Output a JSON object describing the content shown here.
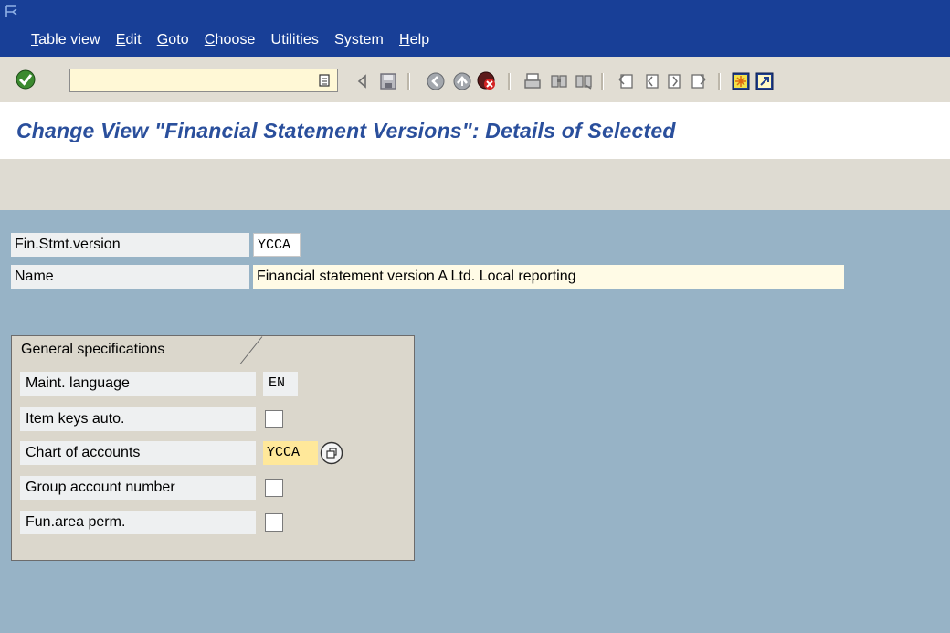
{
  "menu": {
    "items": [
      {
        "mnemonic": "T",
        "rest": "able view"
      },
      {
        "mnemonic": "E",
        "rest": "dit"
      },
      {
        "mnemonic": "G",
        "rest": "oto"
      },
      {
        "mnemonic": "C",
        "rest": "hoose"
      },
      {
        "mnemonic": "",
        "rest": "Utilities"
      },
      {
        "mnemonic": "",
        "rest": "System"
      },
      {
        "mnemonic": "H",
        "rest": "elp"
      }
    ]
  },
  "toolbar": {
    "command_field_value": "",
    "icons": [
      "enter-icon",
      "back-arrow-icon",
      "save-icon",
      "back-icon",
      "exit-icon",
      "cancel-icon",
      "print-icon",
      "find-icon",
      "find-next-icon",
      "first-page-icon",
      "previous-page-icon",
      "next-page-icon",
      "last-page-icon",
      "create-session-icon",
      "shortcut-icon"
    ]
  },
  "page": {
    "title": "Change View \"Financial Statement Versions\": Details of Selected"
  },
  "fields": {
    "fin_stmt_version": {
      "label": "Fin.Stmt.version",
      "value": "YCCA"
    },
    "name": {
      "label": "Name",
      "value": "Financial statement version A Ltd. Local reporting"
    }
  },
  "general_specifications": {
    "title": "General specifications",
    "maint_language": {
      "label": "Maint. language",
      "value": "EN"
    },
    "item_keys_auto": {
      "label": "Item keys auto.",
      "checked": false
    },
    "chart_of_accounts": {
      "label": "Chart of accounts",
      "value": "YCCA"
    },
    "group_account_number": {
      "label": "Group account number",
      "checked": false
    },
    "fun_area_perm": {
      "label": "Fun.area perm.",
      "checked": false
    }
  },
  "colors": {
    "menubar": "#183f97",
    "background": "#97b3c6",
    "title_text": "#2a4f9c",
    "input_yellow": "#fff8d6",
    "highlight_yellow": "#ffe89a"
  }
}
